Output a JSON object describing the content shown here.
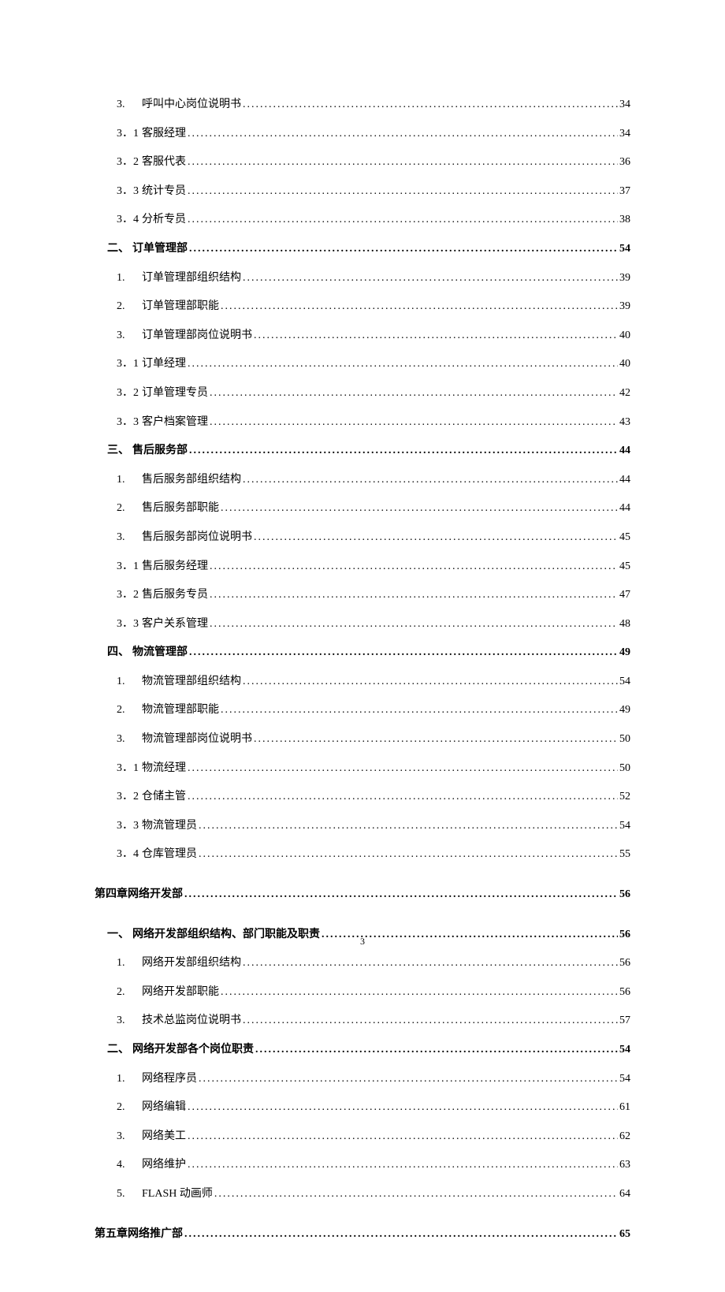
{
  "page_number": "3",
  "entries": [
    {
      "level": 3,
      "num": "3.",
      "title": "呼叫中心岗位说明书",
      "page": "34"
    },
    {
      "level": 4,
      "num": "3．1",
      "title": " 客服经理",
      "page": "34"
    },
    {
      "level": 4,
      "num": "3．2",
      "title": " 客服代表",
      "page": "36"
    },
    {
      "level": 4,
      "num": "3．3",
      "title": " 统计专员",
      "page": "37"
    },
    {
      "level": 4,
      "num": "3．4",
      "title": " 分析专员",
      "page": "38"
    },
    {
      "level": 2,
      "num": "二、",
      "title": "订单管理部",
      "page": "54"
    },
    {
      "level": 3,
      "num": "1.",
      "title": "订单管理部组织结构",
      "page": "39"
    },
    {
      "level": 3,
      "num": "2.",
      "title": "订单管理部职能",
      "page": "39"
    },
    {
      "level": 3,
      "num": "3.",
      "title": "订单管理部岗位说明书",
      "page": "40"
    },
    {
      "level": 4,
      "num": "3．1",
      "title": " 订单经理",
      "page": "40"
    },
    {
      "level": 4,
      "num": "3．2",
      "title": " 订单管理专员",
      "page": "42"
    },
    {
      "level": 4,
      "num": "3．3",
      "title": " 客户档案管理",
      "page": "43"
    },
    {
      "level": 2,
      "num": "三、",
      "title": "售后服务部",
      "page": "44"
    },
    {
      "level": 3,
      "num": "1.",
      "title": "售后服务部组织结构",
      "page": "44"
    },
    {
      "level": 3,
      "num": "2.",
      "title": "售后服务部职能",
      "page": "44"
    },
    {
      "level": 3,
      "num": "3.",
      "title": "售后服务部岗位说明书",
      "page": "45"
    },
    {
      "level": 4,
      "num": "3．1",
      "title": " 售后服务经理",
      "page": "45"
    },
    {
      "level": 4,
      "num": "3．2",
      "title": " 售后服务专员",
      "page": "47"
    },
    {
      "level": 4,
      "num": "3．3",
      "title": " 客户关系管理",
      "page": "48"
    },
    {
      "level": 2,
      "num": "四、",
      "title": "物流管理部",
      "page": "49"
    },
    {
      "level": 3,
      "num": "1.",
      "title": "物流管理部组织结构",
      "page": "54"
    },
    {
      "level": 3,
      "num": "2.",
      "title": "物流管理部职能",
      "page": "49"
    },
    {
      "level": 3,
      "num": "3.",
      "title": "物流管理部岗位说明书",
      "page": "50"
    },
    {
      "level": 4,
      "num": "3．1",
      "title": " 物流经理",
      "page": "50"
    },
    {
      "level": 4,
      "num": "3．2",
      "title": " 仓储主管",
      "page": "52"
    },
    {
      "level": 4,
      "num": "3．3",
      "title": " 物流管理员",
      "page": "54"
    },
    {
      "level": 4,
      "num": "3．4",
      "title": " 仓库管理员",
      "page": "55"
    },
    {
      "level": "spacer"
    },
    {
      "level": 1,
      "num": "第四章",
      "title": "网络开发部",
      "page": "56"
    },
    {
      "level": "spacer"
    },
    {
      "level": 2,
      "num": "一、",
      "title": "网络开发部组织结构、部门职能及职责",
      "page": "56"
    },
    {
      "level": 3,
      "num": "1.",
      "title": "网络开发部组织结构",
      "page": "56"
    },
    {
      "level": 3,
      "num": "2.",
      "title": "网络开发部职能",
      "page": "56"
    },
    {
      "level": 3,
      "num": "3.",
      "title": "技术总监岗位说明书",
      "page": "57"
    },
    {
      "level": 2,
      "num": "二、",
      "title": "网络开发部各个岗位职责",
      "page": "54"
    },
    {
      "level": 3,
      "num": "1.",
      "title": "网络程序员",
      "page": "54"
    },
    {
      "level": 3,
      "num": "2.",
      "title": "网络编辑",
      "page": "61"
    },
    {
      "level": 3,
      "num": "3.",
      "title": "网络美工",
      "page": "62"
    },
    {
      "level": 3,
      "num": "4.",
      "title": "网络维护",
      "page": "63"
    },
    {
      "level": 3,
      "num": "5.",
      "title": "FLASH 动画师",
      "page": "64"
    },
    {
      "level": "spacer"
    },
    {
      "level": 1,
      "num": "第五章",
      "title": "  网络推广部",
      "page": "65"
    }
  ]
}
